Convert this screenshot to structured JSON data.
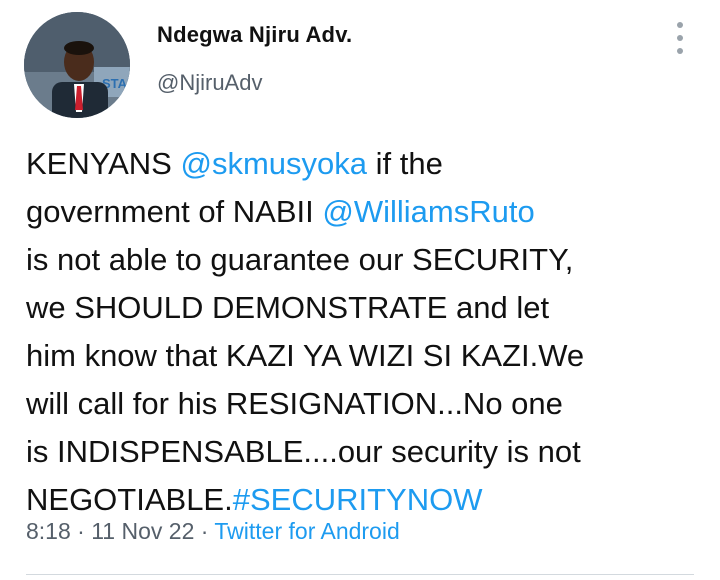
{
  "author": {
    "display_name": "Ndegwa Njiru Adv.",
    "handle": "@NjiruAdv",
    "avatar_watermark": "STAR"
  },
  "menu": {
    "icon": "more-vertical-icon"
  },
  "tweet": {
    "lines": [
      [
        {
          "text": "KENYANS ",
          "type": "text"
        },
        {
          "text": "@skmusyoka",
          "type": "mention"
        },
        {
          "text": " if the",
          "type": "text"
        }
      ],
      [
        {
          "text": "government of NABII ",
          "type": "text"
        },
        {
          "text": "@WilliamsRuto",
          "type": "mention"
        }
      ],
      [
        {
          "text": "is not able to guarantee our SECURITY,",
          "type": "text"
        }
      ],
      [
        {
          "text": "we SHOULD DEMONSTRATE and let",
          "type": "text"
        }
      ],
      [
        {
          "text": "him know that KAZI YA WIZI SI KAZI.We",
          "type": "text"
        }
      ],
      [
        {
          "text": "will call for his RESIGNATION...No one",
          "type": "text"
        }
      ],
      [
        {
          "text": "is INDISPENSABLE....our security is not",
          "type": "text"
        }
      ],
      [
        {
          "text": "NEGOTIABLE.",
          "type": "text"
        },
        {
          "text": "#SECURITYNOW",
          "type": "hashtag"
        }
      ]
    ]
  },
  "meta": {
    "time": "8:18",
    "separator": " · ",
    "date": "11 Nov 22",
    "source": "Twitter for Android"
  },
  "colors": {
    "link": "#1d9bf0",
    "secondary_text": "#555f6a",
    "primary_text": "#111111"
  }
}
